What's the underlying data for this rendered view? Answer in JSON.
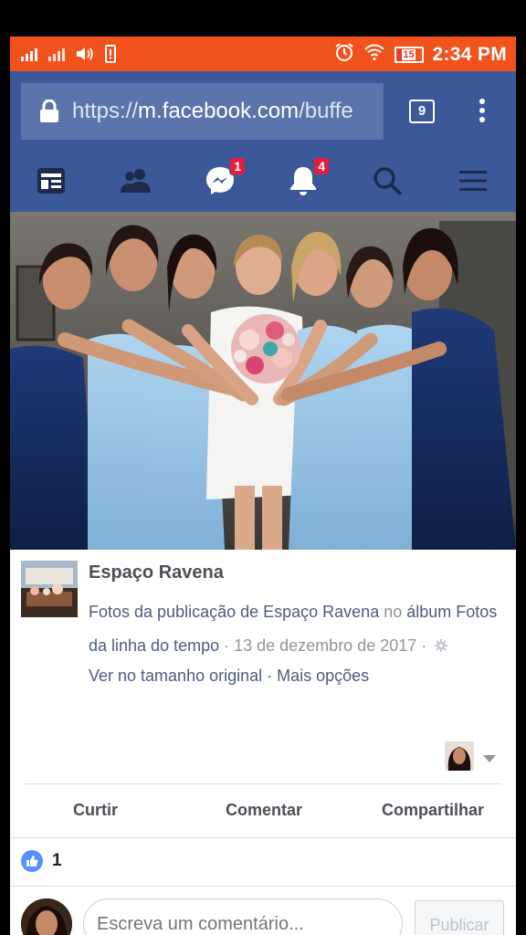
{
  "status_bar": {
    "time": "2:34 PM",
    "battery_level": "15",
    "icons": [
      "signal-icon",
      "signal-2-icon",
      "volume-icon",
      "battery-alert-icon",
      "alarm-icon",
      "wifi-icon",
      "battery-icon"
    ]
  },
  "browser": {
    "url_scheme": "https://",
    "url_host": "m.facebook.com",
    "url_path": "/buffe",
    "tab_count": "9"
  },
  "fb_nav": {
    "items": [
      {
        "name": "news-feed",
        "icon": "news-feed-icon"
      },
      {
        "name": "friends",
        "icon": "friends-icon"
      },
      {
        "name": "messenger",
        "icon": "messenger-icon",
        "badge": "1"
      },
      {
        "name": "notifications",
        "icon": "bell-icon",
        "badge": "4"
      },
      {
        "name": "search",
        "icon": "search-icon"
      },
      {
        "name": "menu",
        "icon": "hamburger-icon"
      }
    ]
  },
  "post": {
    "page_name": "Espaço Ravena",
    "desc_link1": "Fotos da publicação de Espaço Ravena",
    "desc_in": " no ",
    "desc_link2": "álbum Fotos da linha do tempo",
    "desc_date": " · 13 de dezembro de 2017 · ",
    "view_original": "Ver no tamanho original",
    "sep": " · ",
    "more_options": "Mais opções"
  },
  "actions": {
    "like": "Curtir",
    "comment": "Comentar",
    "share": "Compartilhar"
  },
  "likes": {
    "count": "1"
  },
  "comment_box": {
    "placeholder": "Escreva um comentário...",
    "publish": "Publicar"
  },
  "colors": {
    "status_bar": "#f2521c",
    "facebook_blue": "#3b5998",
    "badge_red": "#e41e3f",
    "like_blue": "#5890ff"
  }
}
